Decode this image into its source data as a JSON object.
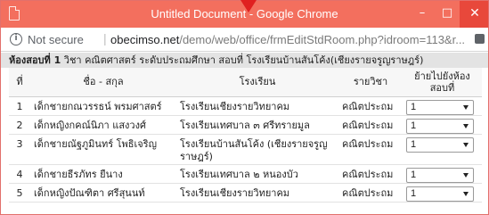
{
  "window": {
    "title": "Untitled Document - Google Chrome",
    "min_symbol": "–",
    "max_symbol": "□",
    "close_symbol": "✕"
  },
  "address": {
    "security_text": "Not secure",
    "separator": "|",
    "domain": "obecimso.net",
    "path": "/demo/web/office/frmEditStdRoom.php?idroom=113&r..."
  },
  "heading": {
    "room_label": "ห้องสอบที่ 1",
    "details": " วิชา คณิตศาสตร์ ระดับประถมศึกษา สอบที่ โรงเรียนบ้านสันโค้ง(เชียงรายจรูญราษฎร์)"
  },
  "table": {
    "columns": [
      "ที่",
      "ชื่อ - สกุล",
      "โรงเรียน",
      "รายวิชา",
      "ย้ายไปยังห้องสอบที่"
    ],
    "rows": [
      {
        "no": "1",
        "name": "เด็กชายกณวรรธน์ พรมศาสตร์",
        "school": "โรงเรียนเชียงรายวิทยาคม",
        "subject": "คณิตประถม",
        "room": "1"
      },
      {
        "no": "2",
        "name": "เด็กหญิงกคณ์นิภา แสงวงศ์",
        "school": "โรงเรียนเทศบาล ๓ ศรีทรายมูล",
        "subject": "คณิตประถม",
        "room": "1"
      },
      {
        "no": "3",
        "name": "เด็กชายณัฐภูมินทร์ โพธิเจริญ",
        "school": "โรงเรียนบ้านสันโค้ง (เชียงรายจรูญราษฎร์)",
        "subject": "คณิตประถม",
        "room": "1"
      },
      {
        "no": "4",
        "name": "เด็กชายธีรภัทร ยืนาง",
        "school": "โรงเรียนเทศบาล ๒ หนองบัว",
        "subject": "คณิตประถม",
        "room": "1"
      },
      {
        "no": "5",
        "name": "เด็กหญิงปัณฑิตา ศรีสุนนท์",
        "school": "โรงเรียนเชียงรายวิทยาคม",
        "subject": "คณิตประถม",
        "room": "1"
      }
    ]
  },
  "colors": {
    "titlebar": "#f36f5e",
    "close_button": "#e8483b",
    "heading_bg": "#e3e3e3"
  }
}
